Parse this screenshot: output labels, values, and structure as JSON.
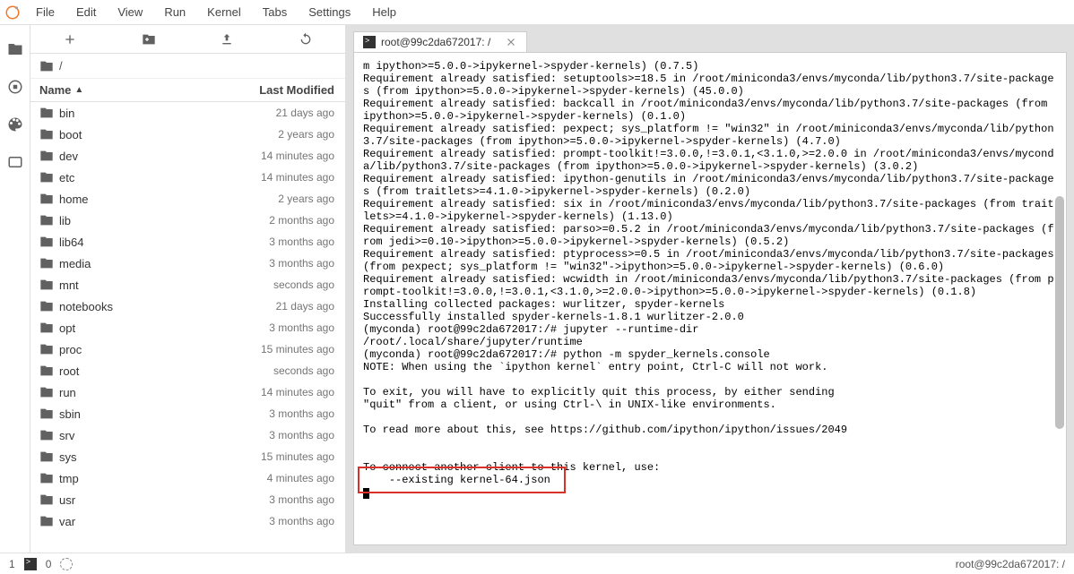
{
  "menu": {
    "items": [
      "File",
      "Edit",
      "View",
      "Run",
      "Kernel",
      "Tabs",
      "Settings",
      "Help"
    ]
  },
  "breadcrumb": {
    "path": "/"
  },
  "file_header": {
    "name": "Name",
    "modified": "Last Modified"
  },
  "files": [
    {
      "name": "bin",
      "mod": "21 days ago"
    },
    {
      "name": "boot",
      "mod": "2 years ago"
    },
    {
      "name": "dev",
      "mod": "14 minutes ago"
    },
    {
      "name": "etc",
      "mod": "14 minutes ago"
    },
    {
      "name": "home",
      "mod": "2 years ago"
    },
    {
      "name": "lib",
      "mod": "2 months ago"
    },
    {
      "name": "lib64",
      "mod": "3 months ago"
    },
    {
      "name": "media",
      "mod": "3 months ago"
    },
    {
      "name": "mnt",
      "mod": "seconds ago"
    },
    {
      "name": "notebooks",
      "mod": "21 days ago"
    },
    {
      "name": "opt",
      "mod": "3 months ago"
    },
    {
      "name": "proc",
      "mod": "15 minutes ago"
    },
    {
      "name": "root",
      "mod": "seconds ago"
    },
    {
      "name": "run",
      "mod": "14 minutes ago"
    },
    {
      "name": "sbin",
      "mod": "3 months ago"
    },
    {
      "name": "srv",
      "mod": "3 months ago"
    },
    {
      "name": "sys",
      "mod": "15 minutes ago"
    },
    {
      "name": "tmp",
      "mod": "4 minutes ago"
    },
    {
      "name": "usr",
      "mod": "3 months ago"
    },
    {
      "name": "var",
      "mod": "3 months ago"
    }
  ],
  "tab": {
    "title": "root@99c2da672017: /"
  },
  "terminal_lines": [
    "m ipython>=5.0.0->ipykernel->spyder-kernels) (0.7.5)",
    "Requirement already satisfied: setuptools>=18.5 in /root/miniconda3/envs/myconda/lib/python3.7/site-packages (from ipython>=5.0.0->ipykernel->spyder-kernels) (45.0.0)",
    "Requirement already satisfied: backcall in /root/miniconda3/envs/myconda/lib/python3.7/site-packages (from ipython>=5.0.0->ipykernel->spyder-kernels) (0.1.0)",
    "Requirement already satisfied: pexpect; sys_platform != \"win32\" in /root/miniconda3/envs/myconda/lib/python3.7/site-packages (from ipython>=5.0.0->ipykernel->spyder-kernels) (4.7.0)",
    "Requirement already satisfied: prompt-toolkit!=3.0.0,!=3.0.1,<3.1.0,>=2.0.0 in /root/miniconda3/envs/myconda/lib/python3.7/site-packages (from ipython>=5.0.0->ipykernel->spyder-kernels) (3.0.2)",
    "Requirement already satisfied: ipython-genutils in /root/miniconda3/envs/myconda/lib/python3.7/site-packages (from traitlets>=4.1.0->ipykernel->spyder-kernels) (0.2.0)",
    "Requirement already satisfied: six in /root/miniconda3/envs/myconda/lib/python3.7/site-packages (from traitlets>=4.1.0->ipykernel->spyder-kernels) (1.13.0)",
    "Requirement already satisfied: parso>=0.5.2 in /root/miniconda3/envs/myconda/lib/python3.7/site-packages (from jedi>=0.10->ipython>=5.0.0->ipykernel->spyder-kernels) (0.5.2)",
    "Requirement already satisfied: ptyprocess>=0.5 in /root/miniconda3/envs/myconda/lib/python3.7/site-packages (from pexpect; sys_platform != \"win32\"->ipython>=5.0.0->ipykernel->spyder-kernels) (0.6.0)",
    "Requirement already satisfied: wcwidth in /root/miniconda3/envs/myconda/lib/python3.7/site-packages (from prompt-toolkit!=3.0.0,!=3.0.1,<3.1.0,>=2.0.0->ipython>=5.0.0->ipykernel->spyder-kernels) (0.1.8)",
    "Installing collected packages: wurlitzer, spyder-kernels",
    "Successfully installed spyder-kernels-1.8.1 wurlitzer-2.0.0",
    "(myconda) root@99c2da672017:/# jupyter --runtime-dir",
    "/root/.local/share/jupyter/runtime",
    "(myconda) root@99c2da672017:/# python -m spyder_kernels.console",
    "NOTE: When using the `ipython kernel` entry point, Ctrl-C will not work.",
    "",
    "To exit, you will have to explicitly quit this process, by either sending",
    "\"quit\" from a client, or using Ctrl-\\ in UNIX-like environments.",
    "",
    "To read more about this, see https://github.com/ipython/ipython/issues/2049",
    "",
    "",
    "To connect another client to this kernel, use:",
    "    --existing kernel-64.json"
  ],
  "statusbar": {
    "left_num1": "1",
    "left_num2": "0",
    "right": "root@99c2da672017: /"
  }
}
